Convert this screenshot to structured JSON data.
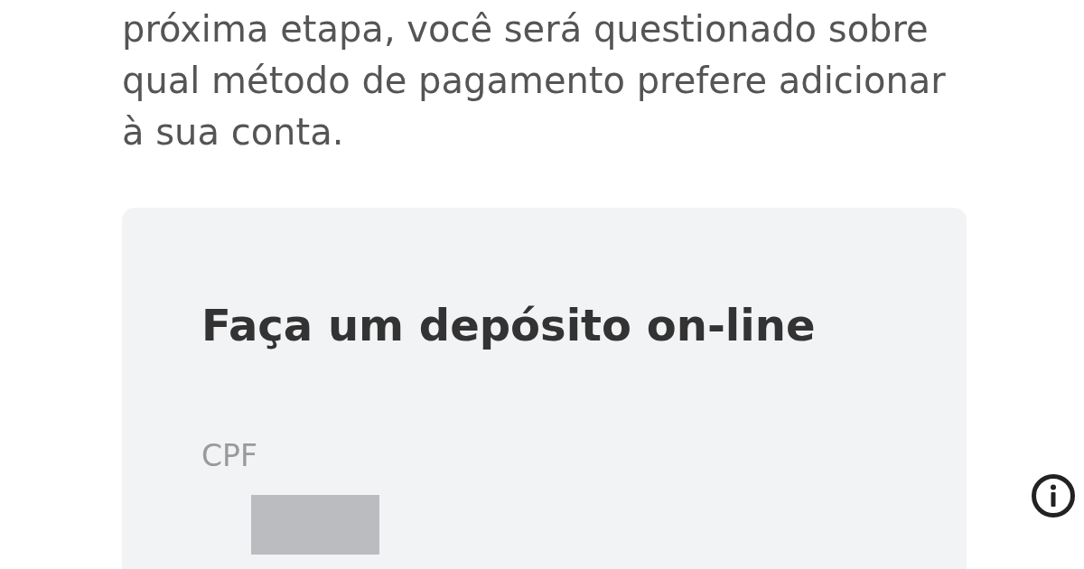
{
  "intro": {
    "text": "próxima etapa, você será questionado sobre qual método de pagamento prefere adicionar à sua conta."
  },
  "deposit_card": {
    "title": "Faça um depósito on-line",
    "fields": [
      {
        "label": "CPF"
      }
    ]
  }
}
